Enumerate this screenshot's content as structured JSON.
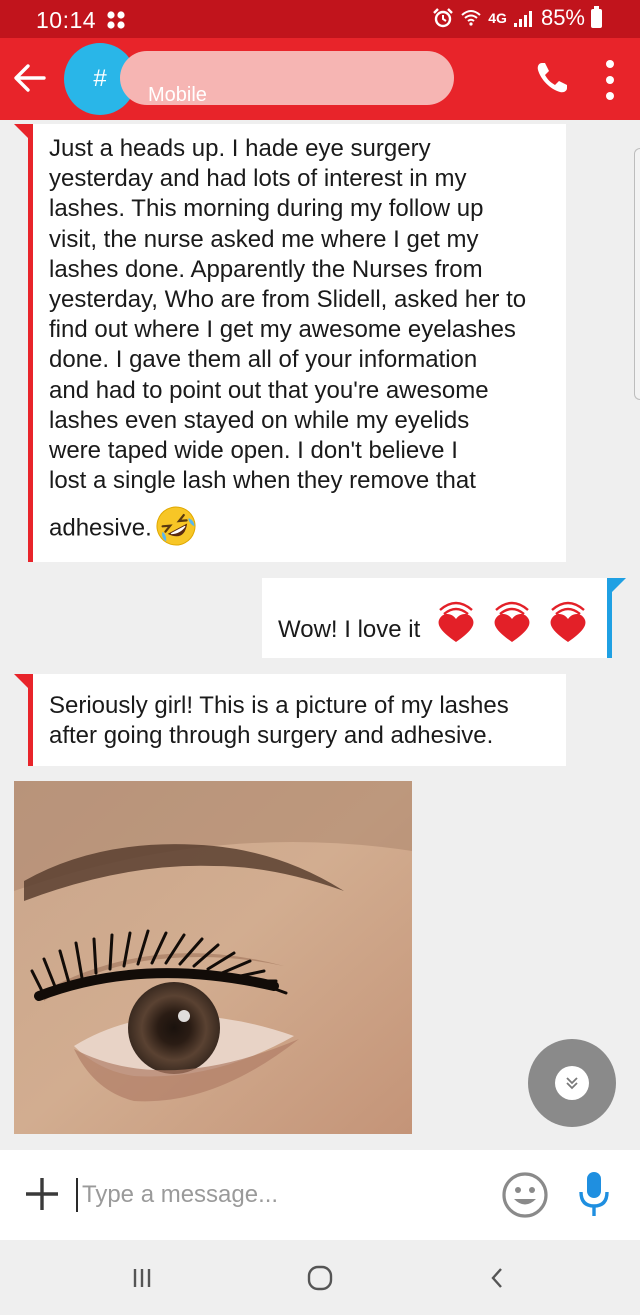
{
  "status_bar": {
    "time": "10:14",
    "network": "4G",
    "battery": "85%"
  },
  "header": {
    "avatar_label": "#",
    "contact_subtitle": "Mobile"
  },
  "messages": [
    {
      "direction": "incoming",
      "lines": [
        "Just a heads up.  I hade eye surgery",
        "yesterday and had lots of interest in my",
        "lashes.  This morning during my follow up",
        "visit,  the nurse asked me where I get my",
        "lashes done.  Apparently the Nurses from",
        "yesterday, Who are from Slidell, asked her to",
        "find out where I get my awesome eyelashes",
        "done.  I gave them all of your information",
        "and had to point out that you're awesome",
        "lashes even stayed on while my eyelids",
        "were taped wide open. I don't believe I",
        "lost a single lash when they remove that",
        "adhesive."
      ],
      "emoji": "rolling-on-floor-laughing"
    },
    {
      "direction": "outgoing",
      "text": "Wow! I love it",
      "emoji": "beating-hearts"
    },
    {
      "direction": "incoming",
      "lines": [
        "Seriously girl! This is a picture of my lashes",
        "after going through surgery and adhesive."
      ]
    },
    {
      "direction": "incoming",
      "type": "image",
      "image": "eye-lashes-photo"
    }
  ],
  "composer": {
    "placeholder": "Type a message..."
  },
  "colors": {
    "status_bar": "#c1141c",
    "app_bar": "#e8242a",
    "avatar": "#29b6e8",
    "incoming_accent": "#e8242a",
    "outgoing_accent": "#1fa0e3"
  }
}
